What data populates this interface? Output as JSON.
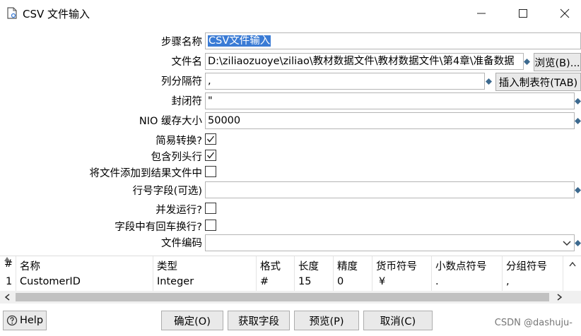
{
  "window": {
    "title": "CSV 文件输入",
    "minimize_label": "minimize",
    "maximize_label": "maximize",
    "close_label": "close"
  },
  "form": {
    "step_name_label": "步骤名称",
    "step_name_value": "CSV文件输入",
    "filename_label": "文件名",
    "filename_value": "D:\\ziliaozuoye\\ziliao\\教材数据文件\\教材数据文件\\第4章\\准备数据",
    "browse_button": "浏览(B)...",
    "delimiter_label": "列分隔符",
    "delimiter_value": ",",
    "insert_tab_button": "插入制表符(TAB)",
    "enclosure_label": "封闭符",
    "enclosure_value": "\"",
    "nio_label": "NIO 缓存大小",
    "nio_value": "50000",
    "lazy_conversion_label": "简易转换?",
    "lazy_conversion_checked": true,
    "header_row_label": "包含列头行",
    "header_row_checked": true,
    "add_to_result_label": "将文件添加到结果文件中",
    "add_to_result_checked": false,
    "rownum_field_label": "行号字段(可选)",
    "rownum_field_value": "",
    "parallel_label": "并发运行?",
    "parallel_checked": false,
    "newlines_label": "字段中有回车换行?",
    "newlines_checked": false,
    "encoding_label": "文件编码",
    "encoding_value": ""
  },
  "grid": {
    "headers": [
      "#",
      "名称",
      "类型",
      "格式",
      "长度",
      "精度",
      "货币符号",
      "小数点符号",
      "分组符号"
    ],
    "rows": [
      [
        "1",
        "CustomerID",
        "Integer",
        "#",
        "15",
        "0",
        "¥",
        ".",
        ","
      ]
    ]
  },
  "buttons": {
    "help": "Help",
    "ok": "确定(O)",
    "get_fields": "获取字段",
    "preview": "预览(P)",
    "cancel": "取消(C)"
  },
  "watermark": "CSDN @dashuju-",
  "colors": {
    "selection": "#3a7bd5",
    "variable_icon": "#3d6a8f"
  }
}
